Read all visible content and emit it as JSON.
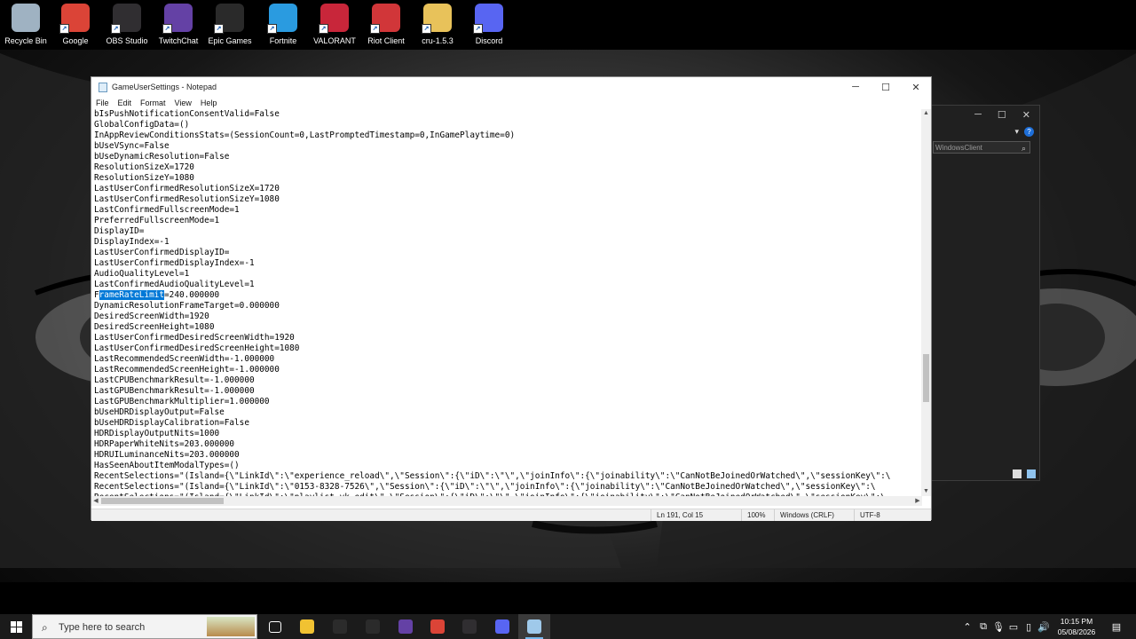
{
  "desktop_icons": [
    {
      "label": "Recycle Bin",
      "icon": "recycle-bin-icon",
      "color": "#9fb2c2"
    },
    {
      "label": "Google",
      "icon": "chrome-icon",
      "color": "#db4437"
    },
    {
      "label": "OBS Studio",
      "icon": "obs-icon",
      "color": "#302e31"
    },
    {
      "label": "TwitchChat",
      "icon": "twitch-chat-icon",
      "color": "#6441a5"
    },
    {
      "label": "Epic Games",
      "icon": "epic-games-icon",
      "color": "#2a2a2a"
    },
    {
      "label": "Fortnite",
      "icon": "fortnite-icon",
      "color": "#2a9be0"
    },
    {
      "label": "VALORANT",
      "icon": "valorant-icon",
      "color": "#c8263a"
    },
    {
      "label": "Riot Client",
      "icon": "riot-client-icon",
      "color": "#d13639"
    },
    {
      "label": "cru-1.5.3",
      "icon": "folder-icon",
      "color": "#e8c25a"
    },
    {
      "label": "Discord",
      "icon": "discord-icon",
      "color": "#5865f2"
    }
  ],
  "background_window": {
    "search_placeholder": "WindowsClient"
  },
  "notepad": {
    "title": "GameUserSettings - Notepad",
    "menu": [
      "File",
      "Edit",
      "Format",
      "View",
      "Help"
    ],
    "lines_before": [
      "bIsPushNotificationConsentValid=False",
      "GlobalConfigData=()",
      "InAppReviewConditionsStats=(SessionCount=0,LastPromptedTimestamp=0,InGamePlaytime=0)",
      "bUseVSync=False",
      "bUseDynamicResolution=False",
      "ResolutionSizeX=1720",
      "ResolutionSizeY=1080",
      "LastUserConfirmedResolutionSizeX=1720",
      "LastUserConfirmedResolutionSizeY=1080",
      "LastConfirmedFullscreenMode=1",
      "PreferredFullscreenMode=1",
      "DisplayID=",
      "DisplayIndex=-1",
      "LastUserConfirmedDisplayID=",
      "LastUserConfirmedDisplayIndex=-1",
      "AudioQualityLevel=1",
      "LastConfirmedAudioQualityLevel=1"
    ],
    "selected_line": {
      "pre": "F",
      "selected": "rameRateLimit",
      "post": "=240.000000"
    },
    "lines_after": [
      "DynamicResolutionFrameTarget=0.000000",
      "DesiredScreenWidth=1920",
      "DesiredScreenHeight=1080",
      "LastUserConfirmedDesiredScreenWidth=1920",
      "LastUserConfirmedDesiredScreenHeight=1080",
      "LastRecommendedScreenWidth=-1.000000",
      "LastRecommendedScreenHeight=-1.000000",
      "LastCPUBenchmarkResult=-1.000000",
      "LastGPUBenchmarkResult=-1.000000",
      "LastGPUBenchmarkMultiplier=1.000000",
      "bUseHDRDisplayOutput=False",
      "bUseHDRDisplayCalibration=False",
      "HDRDisplayOutputNits=1000",
      "HDRPaperWhiteNits=203.000000",
      "HDRUILuminanceNits=203.000000",
      "HasSeenAboutItemModalTypes=()",
      "RecentSelections=\"(Island={\\\"LinkId\\\":\\\"experience_reload\\\",\\\"Session\\\":{\\\"iD\\\":\\\"\\\",\\\"joinInfo\\\":{\\\"joinability\\\":\\\"CanNotBeJoinedOrWatched\\\",\\\"sessionKey\\\":\\",
      "RecentSelections=\"(Island={\\\"LinkId\\\":\\\"0153-8328-7526\\\",\\\"Session\\\":{\\\"iD\\\":\\\"\\\",\\\"joinInfo\\\":{\\\"joinability\\\":\\\"CanNotBeJoinedOrWatched\\\",\\\"sessionKey\\\":\\",
      "RecentSelections=\"(Island={\\\"LinkId\\\":\\\"playlist_vk_edit\\\",\\\"Session\\\":{\\\"iD\\\":\\\"\\\",\\\"joinInfo\\\":{\\\"joinability\\\":\\\"CanNotBeJoinedOrWatched\\\",\\\"sessionKey\\\":\\"
    ],
    "status": {
      "position": "Ln 191, Col 15",
      "zoom": "100%",
      "line_ending": "Windows (CRLF)",
      "encoding": "UTF-8"
    }
  },
  "taskbar": {
    "search_placeholder": "Type here to search",
    "apps": [
      {
        "name": "task-view-icon",
        "color": "#1b1b1b"
      },
      {
        "name": "file-explorer-icon",
        "color": "#f1c232"
      },
      {
        "name": "microsoft-store-icon",
        "color": "#2b2b2b"
      },
      {
        "name": "mail-icon",
        "color": "#2b2b2b"
      },
      {
        "name": "twitch-chat-icon",
        "color": "#6441a5"
      },
      {
        "name": "chrome-icon",
        "color": "#db4437"
      },
      {
        "name": "obs-icon",
        "color": "#302e31"
      },
      {
        "name": "discord-icon",
        "color": "#5865f2"
      },
      {
        "name": "notepad-icon",
        "color": "#9fc9ea"
      }
    ],
    "time": "10:15 PM",
    "date": "05/08/2026"
  }
}
